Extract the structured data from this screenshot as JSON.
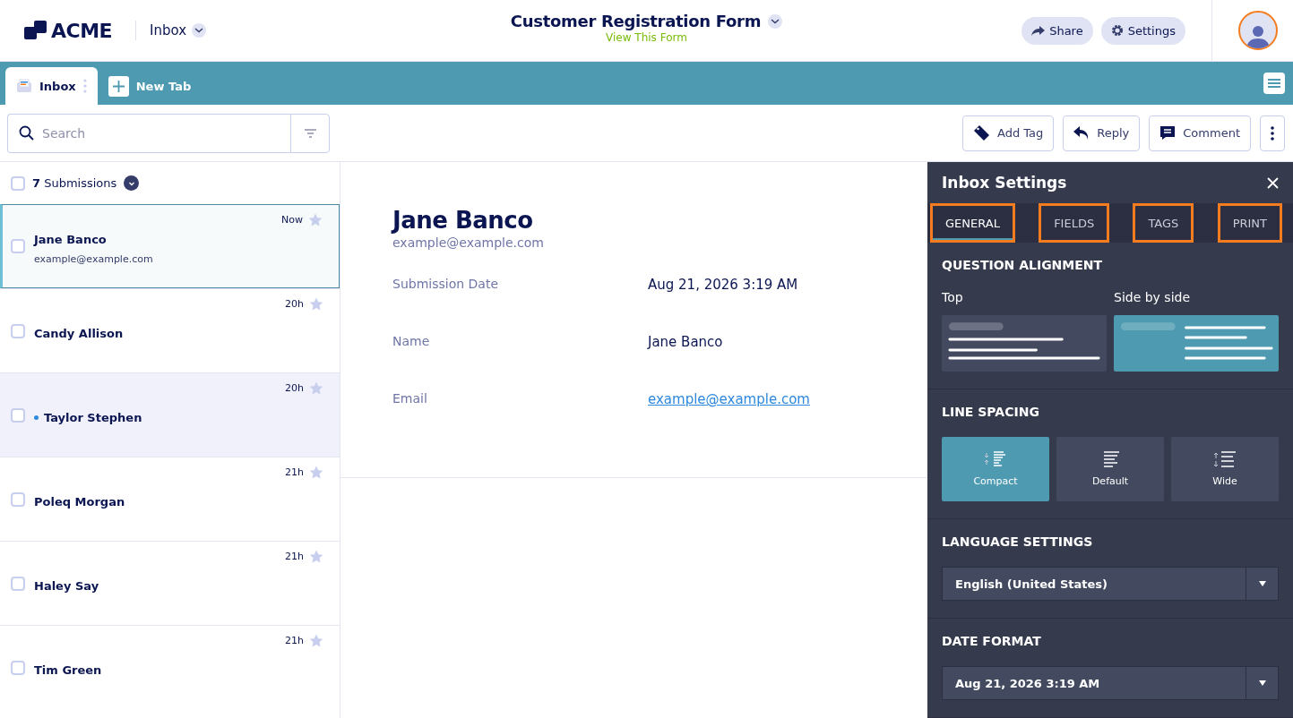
{
  "header": {
    "logo": "ACME",
    "inbox_menu": "Inbox",
    "form_title": "Customer Registration Form",
    "form_link": "View This Form",
    "buttons": [
      {
        "label": "Share",
        "kind": "share"
      },
      {
        "label": "Settings",
        "kind": "settings"
      }
    ]
  },
  "tabs": [
    {
      "label": "Inbox",
      "kind": "inbox",
      "selected": true
    },
    {
      "label": "New Tab",
      "kind": "new",
      "selected": false
    }
  ],
  "toolbar": {
    "search": {
      "placeholder": "Search"
    },
    "actions": [
      {
        "label": "Add Tag",
        "kind": "tag"
      },
      {
        "label": "Reply",
        "kind": "reply"
      },
      {
        "label": "Comment",
        "kind": "comment"
      },
      {
        "kind": "more"
      }
    ]
  },
  "submissions": {
    "count_label": "**7** Submissions",
    "checked": false,
    "items": [
      {
        "name": "Jane Banco",
        "email": "example@example.com",
        "time": "Now",
        "selected": true,
        "unread": false,
        "checked": false,
        "starred": false
      },
      {
        "name": "Candy Allison",
        "time": "20h",
        "selected": false,
        "unread": false,
        "checked": false,
        "starred": false
      },
      {
        "name": "Taylor Stephen",
        "time": "20h",
        "selected": false,
        "unread": true,
        "checked": false,
        "starred": false
      },
      {
        "name": "Poleq Morgan",
        "time": "21h",
        "selected": false,
        "unread": false,
        "checked": false,
        "starred": false
      },
      {
        "name": "Haley Say",
        "time": "21h",
        "selected": false,
        "unread": false,
        "checked": false,
        "starred": false
      },
      {
        "name": "Tim Green",
        "time": "21h",
        "selected": false,
        "unread": false,
        "checked": false,
        "starred": false
      }
    ]
  },
  "detail": {
    "name": "Jane Banco",
    "email": "example@example.com",
    "fields": [
      {
        "label": "Submission Date",
        "value": "Aug 21, 2026 3:19 AM",
        "kind": "text"
      },
      {
        "label": "Name",
        "value": "Jane Banco",
        "kind": "text"
      },
      {
        "label": "Email",
        "value": "example@example.com",
        "kind": "link"
      }
    ]
  },
  "settings_panel": {
    "title": "Inbox Settings",
    "tabs": [
      {
        "label": "GENERAL",
        "selected": true,
        "highlighted": true
      },
      {
        "label": "FIELDS",
        "selected": false,
        "highlighted": true
      },
      {
        "label": "TAGS",
        "selected": false,
        "highlighted": true
      },
      {
        "label": "PRINT",
        "selected": false,
        "highlighted": true
      }
    ],
    "question_alignment": {
      "heading": "QUESTION ALIGNMENT",
      "options": [
        {
          "label": "Top",
          "kind": "top",
          "selected": false
        },
        {
          "label": "Side by side",
          "kind": "side",
          "selected": true
        }
      ]
    },
    "line_spacing": {
      "heading": "LINE SPACING",
      "options": [
        {
          "label": "Compact",
          "kind": "compact",
          "selected": true
        },
        {
          "label": "Default",
          "kind": "default",
          "selected": false
        },
        {
          "label": "Wide",
          "kind": "wide",
          "selected": false
        }
      ]
    },
    "language": {
      "heading": "LANGUAGE SETTINGS",
      "value": "English (United States)"
    },
    "date_format": {
      "heading": "DATE FORMAT",
      "value": "Aug 21, 2026 3:19 AM"
    }
  }
}
